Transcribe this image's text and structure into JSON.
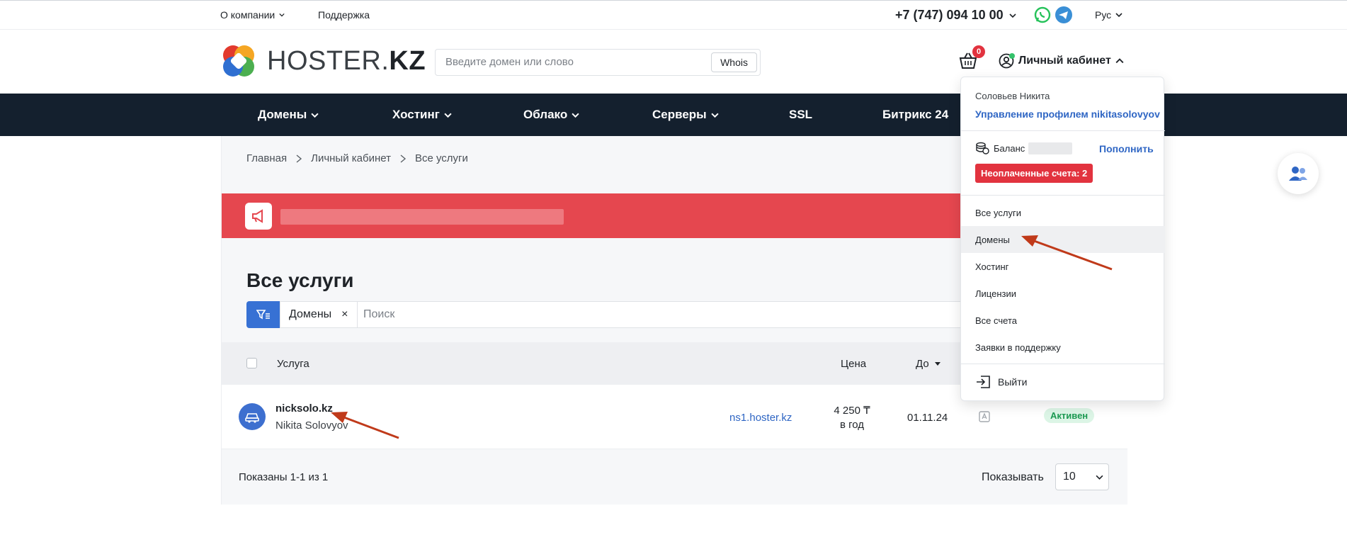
{
  "topbar": {
    "about": "О компании",
    "support": "Поддержка",
    "phone": "+7 (747) 094 10 00",
    "lang": "Рус"
  },
  "header": {
    "logo_light": "HOSTER.",
    "logo_bold": "KZ",
    "search_placeholder": "Введите домен или слово",
    "whois_label": "Whois",
    "cart_count": "0",
    "account_label": "Личный кабинет"
  },
  "nav": {
    "items": [
      "Домены",
      "Хостинг",
      "Облако",
      "Серверы",
      "SSL",
      "Битрикс 24"
    ]
  },
  "breadcrumb": [
    "Главная",
    "Личный кабинет",
    "Все услуги"
  ],
  "page": {
    "title": "Все услуги",
    "filter_chip": "Домены",
    "chip_close": "×",
    "search_placeholder": "Поиск"
  },
  "table": {
    "headers": {
      "service": "Услуга",
      "price": "Цена",
      "until": "До"
    },
    "rows": [
      {
        "domain": "nicksolo.kz",
        "owner": "Nikita Solovyov",
        "ns": "ns1.hoster.kz",
        "price_amount": "4 250 ₸",
        "price_period": "в год",
        "until": "01.11.24",
        "status": "Активен"
      }
    ]
  },
  "footer": {
    "shown": "Показаны 1-1 из 1",
    "show_label": "Показывать",
    "per_page": "10"
  },
  "dropdown": {
    "user": "Соловьев Никита",
    "profile_link": "Управление профилем nikitasolovyov",
    "balance_label": "Баланс",
    "topup": "Пополнить",
    "unpaid": "Неоплаченные счета: 2",
    "items": [
      "Все услуги",
      "Домены",
      "Хостинг",
      "Лицензии",
      "Все счета",
      "Заявки в поддержку"
    ],
    "logout": "Выйти"
  },
  "colors": {
    "nav_bg": "#14202e",
    "banner": "#e5474f",
    "accent_blue": "#3771d4",
    "link_blue": "#2f66c4",
    "status_green": "#1c9a52",
    "badge_red": "#e2333f",
    "annotation_arrow": "#c03a1a"
  }
}
